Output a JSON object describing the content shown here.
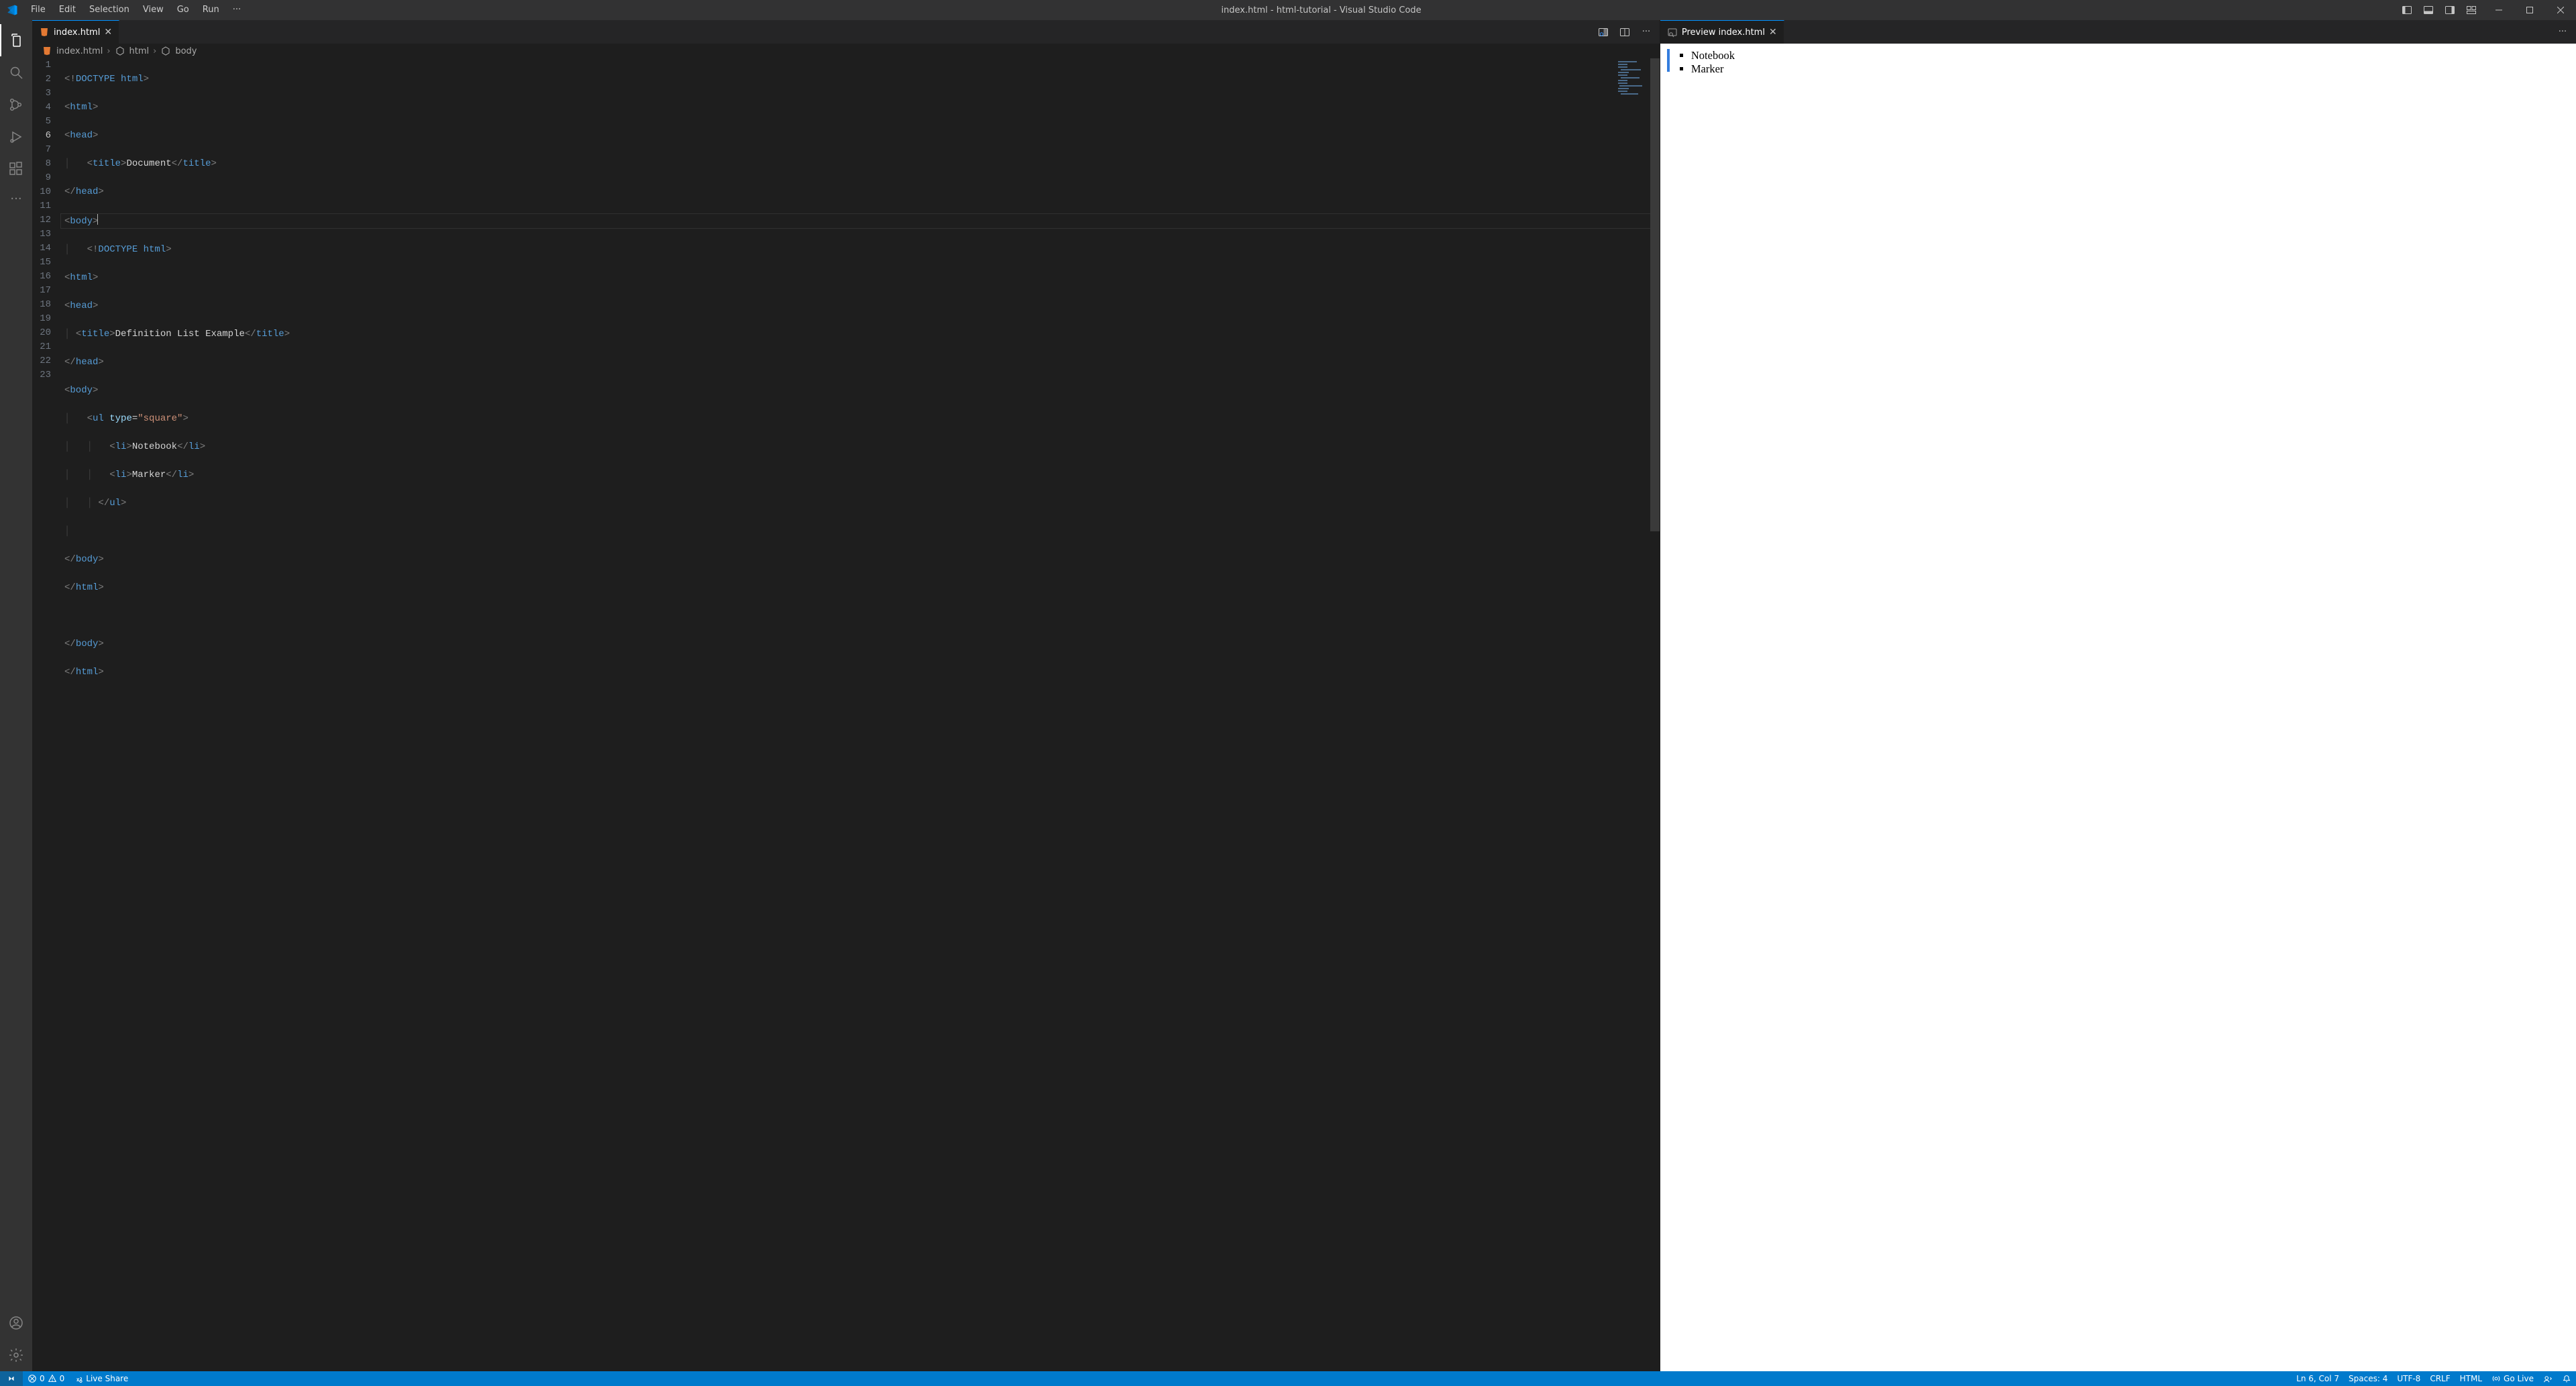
{
  "titlebar": {
    "menus": [
      "File",
      "Edit",
      "Selection",
      "View",
      "Go",
      "Run"
    ],
    "title": "index.html - html-tutorial - Visual Studio Code"
  },
  "tabs": {
    "left": {
      "label": "index.html"
    },
    "right": {
      "label": "Preview index.html"
    }
  },
  "breadcrumbs": {
    "file": "index.html",
    "sym1": "html",
    "sym2": "body"
  },
  "code": {
    "numbers": [
      "1",
      "2",
      "3",
      "4",
      "5",
      "6",
      "7",
      "8",
      "9",
      "10",
      "11",
      "12",
      "13",
      "14",
      "15",
      "16",
      "17",
      "18",
      "19",
      "20",
      "21",
      "22",
      "23"
    ],
    "l1_doctype": "DOCTYPE html",
    "l4_title": "Document",
    "l7_doctype": "DOCTYPE html",
    "l10_title": "Definition List Example",
    "l13_type_attr": "type",
    "l13_type_val": "\"square\"",
    "l14_item": "Notebook",
    "l15_item": "Marker",
    "tag_html": "html",
    "tag_head": "head",
    "tag_title": "title",
    "tag_body": "body",
    "tag_ul": "ul",
    "tag_li": "li"
  },
  "preview": {
    "items": [
      "Notebook",
      "Marker"
    ]
  },
  "status": {
    "errors": "0",
    "warnings": "0",
    "live_share": "Live Share",
    "cursor": "Ln 6, Col 7",
    "spaces": "Spaces: 4",
    "encoding": "UTF-8",
    "eol": "CRLF",
    "lang": "HTML",
    "go_live": "Go Live"
  }
}
